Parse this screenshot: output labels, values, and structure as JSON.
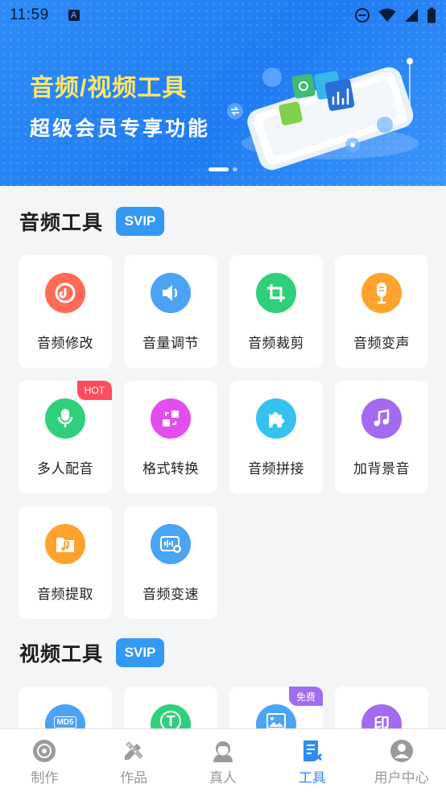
{
  "status": {
    "time": "11:59",
    "keyboard_glyph": "A"
  },
  "banner": {
    "title_line1": "音频/视频工具",
    "title_line2": "超级会员专享功能",
    "page_count": 2,
    "active_index": 0
  },
  "audio_section": {
    "title": "音频工具",
    "badge": "SVIP",
    "tools": [
      {
        "label": "音频修改",
        "icon": "audio-edit-icon",
        "color": "#ff6b57"
      },
      {
        "label": "音量调节",
        "icon": "volume-icon",
        "color": "#4aa3f5"
      },
      {
        "label": "音频裁剪",
        "icon": "crop-icon",
        "color": "#2fd07c"
      },
      {
        "label": "音频变声",
        "icon": "microphone-icon",
        "color": "#ffa22e"
      },
      {
        "label": "多人配音",
        "icon": "multi-dub-mic-icon",
        "color": "#2fd07c",
        "badge": "HOT"
      },
      {
        "label": "格式转换",
        "icon": "format-convert-icon",
        "color": "#e64df0"
      },
      {
        "label": "音频拼接",
        "icon": "puzzle-icon",
        "color": "#36c2f0"
      },
      {
        "label": "加背景音",
        "icon": "music-note-icon",
        "color": "#a46af2"
      },
      {
        "label": "音频提取",
        "icon": "music-folder-icon",
        "color": "#ffa22e"
      },
      {
        "label": "音频变速",
        "icon": "speed-icon",
        "color": "#4aa3f5"
      }
    ]
  },
  "video_section": {
    "title": "视频工具",
    "badge": "SVIP",
    "tools": [
      {
        "icon": "md5-icon",
        "icon_text": "MD5",
        "color": "#4aa3f5"
      },
      {
        "icon": "text-icon",
        "icon_text": "T",
        "color": "#2fd07c"
      },
      {
        "icon": "image-icon",
        "color": "#4aa3f5",
        "badge": "免费"
      },
      {
        "icon": "watermark-icon",
        "icon_text": "印",
        "color": "#a46af2"
      }
    ]
  },
  "tabbar": {
    "items": [
      {
        "label": "制作",
        "icon": "disc-icon",
        "active": false
      },
      {
        "label": "作品",
        "icon": "pencil-ruler-icon",
        "active": false
      },
      {
        "label": "真人",
        "icon": "person-avatar-icon",
        "active": false
      },
      {
        "label": "工具",
        "icon": "tool-document-icon",
        "active": true
      },
      {
        "label": "用户中心",
        "icon": "user-icon",
        "active": false
      }
    ]
  },
  "colors": {
    "accent": "#2f8cf5",
    "banner_blue": "#1f7cf2",
    "banner_title_yellow": "#ffe66a",
    "svip_badge": "#3498f5",
    "hot_badge": "#ff4d5c",
    "free_badge": "#a06cf2",
    "inactive_tab": "#9a9a9a"
  }
}
